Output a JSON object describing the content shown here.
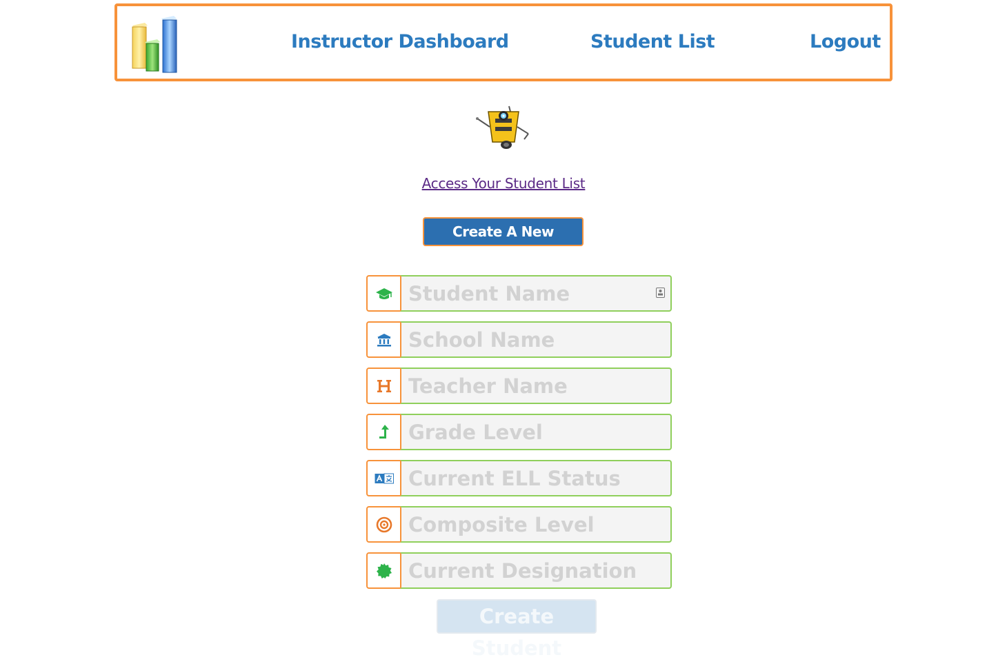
{
  "nav": {
    "logo_icon": "bar-chart-logo-icon",
    "links": {
      "dashboard": "Instructor Dashboard",
      "student_list": "Student List",
      "logout": "Logout"
    }
  },
  "mascot_icon": "robot-mascot-icon",
  "access_link": "Access Your Student List",
  "create_new_button": "Create A New Student",
  "form": {
    "fields": [
      {
        "icon": "graduation-cap-icon",
        "placeholder": "Student Name"
      },
      {
        "icon": "bank-icon",
        "placeholder": "School Name"
      },
      {
        "icon": "header-h-icon",
        "placeholder": "Teacher Name"
      },
      {
        "icon": "level-up-icon",
        "placeholder": "Grade Level"
      },
      {
        "icon": "translate-icon",
        "placeholder": "Current ELL Status"
      },
      {
        "icon": "bullseye-icon",
        "placeholder": "Composite Level"
      },
      {
        "icon": "certificate-icon",
        "placeholder": "Current Designation"
      }
    ],
    "submit_label": "Create Student"
  },
  "colors": {
    "accent_orange": "#f7923a",
    "link_blue": "#2c7bbf",
    "field_green_border": "#8fcf5b",
    "button_blue": "#2c6fb0"
  }
}
